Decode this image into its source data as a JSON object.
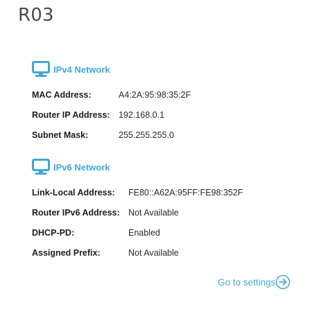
{
  "device": {
    "title": "R03"
  },
  "ipv4": {
    "title": "IPv4 Network",
    "icon": "monitor-icon",
    "rows": [
      {
        "label": "MAC Address:",
        "value": "A4:2A:95:98:35:2F"
      },
      {
        "label": "Router IP Address:",
        "value": "192.168.0.1"
      },
      {
        "label": "Subnet Mask:",
        "value": "255.255.255.0"
      }
    ]
  },
  "ipv6": {
    "title": "IPv6 Network",
    "icon": "monitor-icon",
    "rows": [
      {
        "label": "Link-Local Address:",
        "value": "FE80::A62A:95FF:FE98:352F"
      },
      {
        "label": "Router IPv6 Address:",
        "value": "Not Available"
      },
      {
        "label": "DHCP-PD:",
        "value": "Enabled"
      },
      {
        "label": "Assigned Prefix:",
        "value": "Not Available"
      }
    ]
  },
  "settings_link": {
    "label": "Go to settings",
    "icon": "arrow-circle-right-icon"
  },
  "colors": {
    "accent": "#3fa9d6",
    "title": "#4a4a4a"
  }
}
